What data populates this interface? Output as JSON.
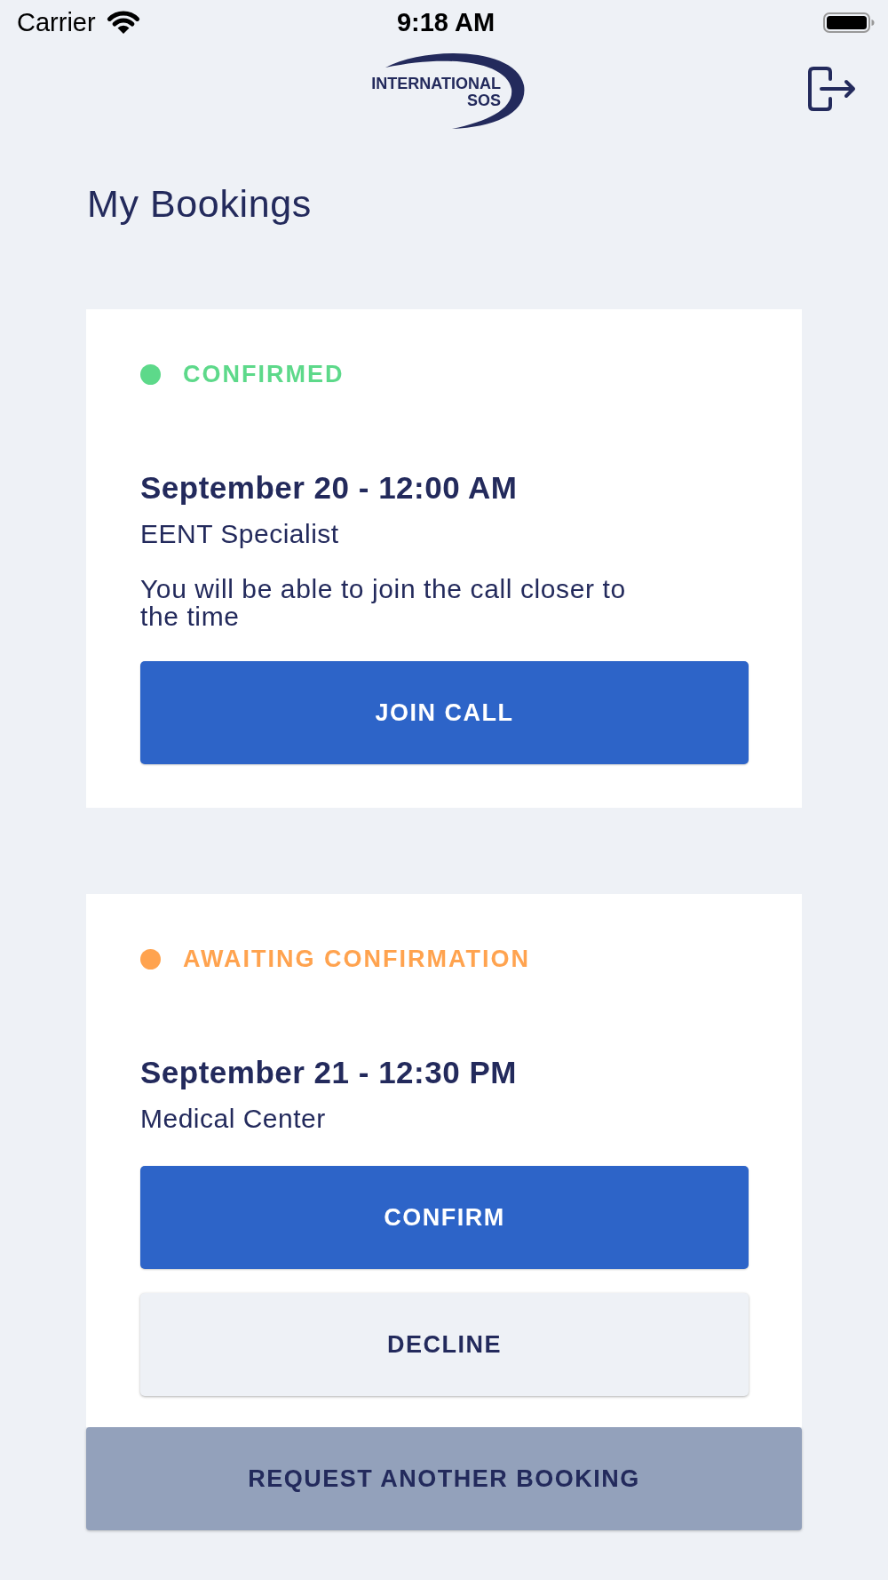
{
  "status_bar": {
    "carrier": "Carrier",
    "time": "9:18 AM"
  },
  "header": {
    "logo_lines": [
      "INTERNATIONAL",
      "SOS"
    ]
  },
  "title": "My Bookings",
  "bookings": [
    {
      "status": "CONFIRMED",
      "color": "#5dd98a",
      "date": "September 20 - 12:00 AM",
      "type": "EENT Specialist",
      "note": "You will be able to join the call closer to the time",
      "actions": [
        {
          "label": "JOIN CALL",
          "kind": "primary"
        }
      ]
    },
    {
      "status": "AWAITING CONFIRMATION",
      "color": "#ffa34f",
      "date": "September 21 - 12:30 PM",
      "type": "Medical Center",
      "actions": [
        {
          "label": "CONFIRM",
          "kind": "primary"
        },
        {
          "label": "DECLINE",
          "kind": "secondary"
        }
      ]
    }
  ],
  "footer_button": "REQUEST ANOTHER BOOKING"
}
